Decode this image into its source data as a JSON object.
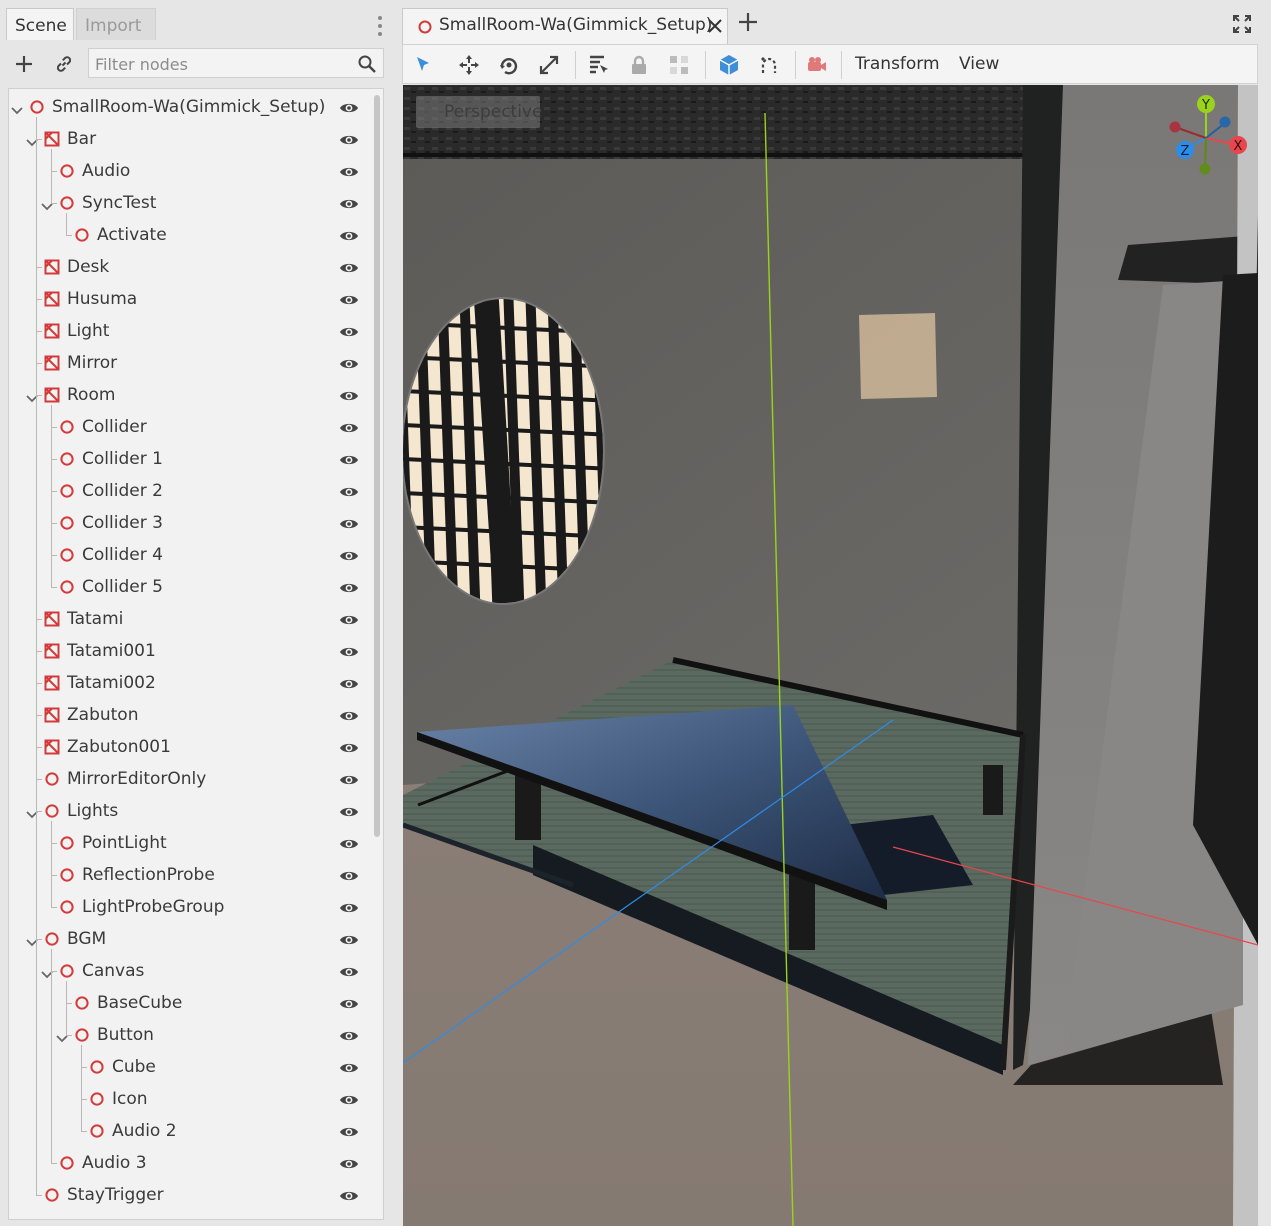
{
  "dock": {
    "tabs": [
      {
        "label": "Scene",
        "active": true
      },
      {
        "label": "Import",
        "active": false
      }
    ],
    "filter_placeholder": "Filter nodes",
    "icons": {
      "add": "plus-icon",
      "link": "link-icon",
      "search": "search-icon",
      "menu": "kebab-icon"
    }
  },
  "tree": [
    {
      "label": "SmallRoom-Wa(Gimmick_Setup)",
      "depth": 0,
      "icon": "node-3d-icon",
      "expanded": true
    },
    {
      "label": "Bar",
      "depth": 1,
      "icon": "mesh-icon",
      "expanded": true
    },
    {
      "label": "Audio",
      "depth": 2,
      "icon": "node-3d-icon"
    },
    {
      "label": "SyncTest",
      "depth": 2,
      "icon": "node-3d-icon",
      "expanded": true
    },
    {
      "label": "Activate",
      "depth": 3,
      "icon": "node-3d-icon"
    },
    {
      "label": "Desk",
      "depth": 1,
      "icon": "mesh-icon"
    },
    {
      "label": "Husuma",
      "depth": 1,
      "icon": "mesh-icon"
    },
    {
      "label": "Light",
      "depth": 1,
      "icon": "mesh-icon"
    },
    {
      "label": "Mirror",
      "depth": 1,
      "icon": "mesh-icon"
    },
    {
      "label": "Room",
      "depth": 1,
      "icon": "mesh-icon",
      "expanded": true
    },
    {
      "label": "Collider",
      "depth": 2,
      "icon": "node-3d-icon"
    },
    {
      "label": "Collider 1",
      "depth": 2,
      "icon": "node-3d-icon"
    },
    {
      "label": "Collider 2",
      "depth": 2,
      "icon": "node-3d-icon"
    },
    {
      "label": "Collider 3",
      "depth": 2,
      "icon": "node-3d-icon"
    },
    {
      "label": "Collider 4",
      "depth": 2,
      "icon": "node-3d-icon"
    },
    {
      "label": "Collider 5",
      "depth": 2,
      "icon": "node-3d-icon"
    },
    {
      "label": "Tatami",
      "depth": 1,
      "icon": "mesh-icon"
    },
    {
      "label": "Tatami001",
      "depth": 1,
      "icon": "mesh-icon"
    },
    {
      "label": "Tatami002",
      "depth": 1,
      "icon": "mesh-icon"
    },
    {
      "label": "Zabuton",
      "depth": 1,
      "icon": "mesh-icon"
    },
    {
      "label": "Zabuton001",
      "depth": 1,
      "icon": "mesh-icon"
    },
    {
      "label": "MirrorEditorOnly",
      "depth": 1,
      "icon": "node-3d-icon"
    },
    {
      "label": "Lights",
      "depth": 1,
      "icon": "node-3d-icon",
      "expanded": true
    },
    {
      "label": "PointLight",
      "depth": 2,
      "icon": "node-3d-icon"
    },
    {
      "label": "ReflectionProbe",
      "depth": 2,
      "icon": "node-3d-icon"
    },
    {
      "label": "LightProbeGroup",
      "depth": 2,
      "icon": "node-3d-icon"
    },
    {
      "label": "BGM",
      "depth": 1,
      "icon": "node-3d-icon",
      "expanded": true
    },
    {
      "label": "Canvas",
      "depth": 2,
      "icon": "node-3d-icon",
      "expanded": true
    },
    {
      "label": "BaseCube",
      "depth": 3,
      "icon": "node-3d-icon"
    },
    {
      "label": "Button",
      "depth": 3,
      "icon": "node-3d-icon",
      "expanded": true
    },
    {
      "label": "Cube",
      "depth": 4,
      "icon": "node-3d-icon"
    },
    {
      "label": "Icon",
      "depth": 4,
      "icon": "node-3d-icon"
    },
    {
      "label": "Audio 2",
      "depth": 4,
      "icon": "node-3d-icon"
    },
    {
      "label": "Audio 3",
      "depth": 2,
      "icon": "node-3d-icon"
    },
    {
      "label": "StayTrigger",
      "depth": 1,
      "icon": "node-3d-icon"
    }
  ],
  "editor": {
    "tab_label": "SmallRoom-Wa(Gimmick_Setup)",
    "menus": {
      "transform": "Transform",
      "view": "View"
    },
    "viewport_label": "Perspective",
    "gizmo": {
      "y": "Y",
      "x": "X",
      "z": "Z"
    }
  },
  "colors": {
    "node_red": "#d33b3b",
    "accent_blue": "#3f8fd8",
    "axis_green": "#9ad31a",
    "axis_red": "#e8464d",
    "axis_blue": "#2d8ce8"
  }
}
